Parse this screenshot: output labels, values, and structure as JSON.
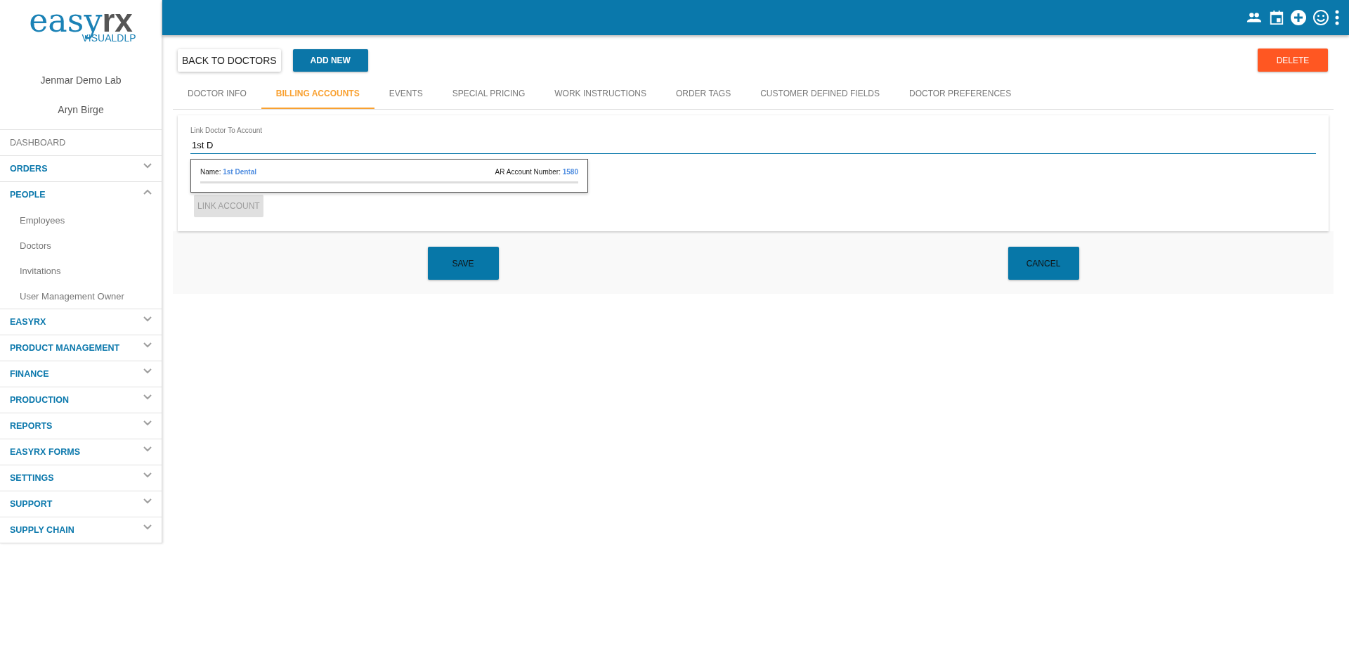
{
  "logo": {
    "word": "easy",
    "accent": "rx",
    "sub": "VISUALDLP"
  },
  "sidebar": {
    "lab": "Jenmar Demo Lab",
    "user": "Aryn Birge",
    "items": [
      {
        "kind": "link",
        "label": "DASHBOARD"
      },
      {
        "kind": "section",
        "label": "ORDERS",
        "expanded": false
      },
      {
        "kind": "section",
        "label": "PEOPLE",
        "expanded": true,
        "children": [
          {
            "label": "Employees"
          },
          {
            "label": "Doctors"
          },
          {
            "label": "Invitations"
          },
          {
            "label": "User Management Owner"
          }
        ]
      },
      {
        "kind": "section",
        "label": "EASYRX",
        "expanded": false
      },
      {
        "kind": "section",
        "label": "PRODUCT MANAGEMENT",
        "expanded": false
      },
      {
        "kind": "section",
        "label": "FINANCE",
        "expanded": false
      },
      {
        "kind": "section",
        "label": "PRODUCTION",
        "expanded": false
      },
      {
        "kind": "section",
        "label": "REPORTS",
        "expanded": false
      },
      {
        "kind": "section",
        "label": "EASYRX FORMS",
        "expanded": false
      },
      {
        "kind": "section",
        "label": "SETTINGS",
        "expanded": false
      },
      {
        "kind": "section",
        "label": "SUPPORT",
        "expanded": false
      },
      {
        "kind": "section",
        "label": "SUPPLY CHAIN",
        "expanded": false
      }
    ]
  },
  "toolbar": {
    "back": "BACK TO DOCTORS",
    "add": "ADD NEW",
    "delete": "DELETE"
  },
  "tabs": [
    {
      "label": "DOCTOR INFO",
      "selected": false
    },
    {
      "label": "BILLING ACCOUNTS",
      "selected": true
    },
    {
      "label": "EVENTS",
      "selected": false
    },
    {
      "label": "SPECIAL PRICING",
      "selected": false
    },
    {
      "label": "WORK INSTRUCTIONS",
      "selected": false
    },
    {
      "label": "ORDER TAGS",
      "selected": false
    },
    {
      "label": "CUSTOMER DEFINED FIELDS",
      "selected": false
    },
    {
      "label": "DOCTOR PREFERENCES",
      "selected": false
    }
  ],
  "link_form": {
    "label": "Link Doctor To Account",
    "value": "1st D",
    "suggestions": [
      {
        "name_label": "Name:",
        "name": "1st Dental",
        "number_label": "AR Account Number:",
        "number": "1580"
      }
    ],
    "button": {
      "label": "LINK ACCOUNT",
      "disabled": true
    }
  },
  "actions": {
    "save": "SAVE",
    "cancel": "CANCEL"
  }
}
